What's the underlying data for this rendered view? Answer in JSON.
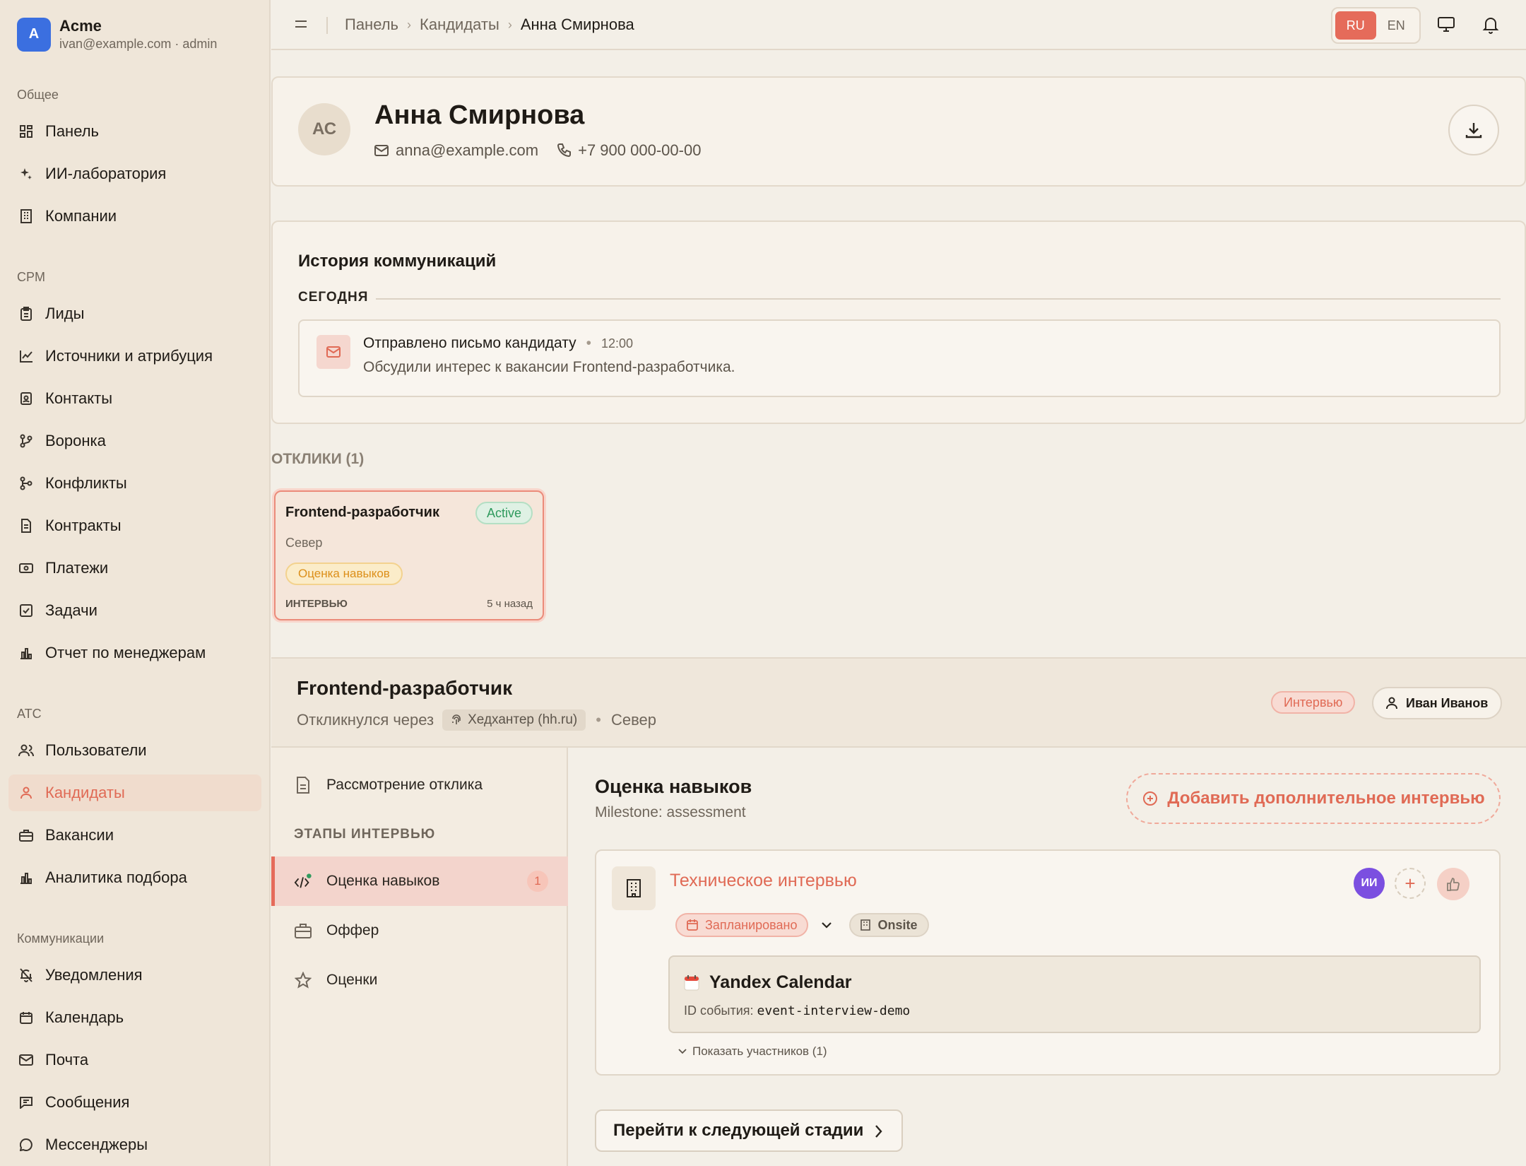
{
  "brand": {
    "initial": "A",
    "name": "Acme",
    "account": "ivan@example.com · admin"
  },
  "sidebar": {
    "sections": {
      "general": "Общее",
      "crm": "CPM",
      "ats": "ATC",
      "comms": "Коммуникации"
    },
    "items": [
      {
        "label": "Панель",
        "icon": "dashboard-icon"
      },
      {
        "label": "ИИ-лаборатория",
        "icon": "sparkles-icon"
      },
      {
        "label": "Компании",
        "icon": "building-icon"
      },
      {
        "label": "Лиды",
        "icon": "clipboard-icon"
      },
      {
        "label": "Источники и атрибуция",
        "icon": "chart-line-icon"
      },
      {
        "label": "Контакты",
        "icon": "contact-card-icon"
      },
      {
        "label": "Воронка",
        "icon": "funnel-icon"
      },
      {
        "label": "Конфликты",
        "icon": "git-branch-icon"
      },
      {
        "label": "Контракты",
        "icon": "document-icon"
      },
      {
        "label": "Платежи",
        "icon": "banknote-icon"
      },
      {
        "label": "Задачи",
        "icon": "checkbox-icon"
      },
      {
        "label": "Отчет по менеджерам",
        "icon": "bar-chart-icon"
      },
      {
        "label": "Пользователи",
        "icon": "users-icon"
      },
      {
        "label": "Кандидаты",
        "icon": "user-icon"
      },
      {
        "label": "Вакансии",
        "icon": "briefcase-icon"
      },
      {
        "label": "Аналитика подбора",
        "icon": "bar-chart-icon"
      },
      {
        "label": "Уведомления",
        "icon": "bell-off-icon"
      },
      {
        "label": "Календарь",
        "icon": "calendar-icon"
      },
      {
        "label": "Почта",
        "icon": "mail-icon"
      },
      {
        "label": "Сообщения",
        "icon": "message-square-icon"
      },
      {
        "label": "Мессенджеры",
        "icon": "message-circle-icon"
      }
    ],
    "active": "Кандидаты"
  },
  "topbar": {
    "breadcrumbs": [
      "Панель",
      "Кандидаты",
      "Анна Смирнова"
    ],
    "lang_on": "RU",
    "lang_off": "EN"
  },
  "candidate": {
    "initials": "АС",
    "name": "Анна Смирнова",
    "email": "anna@example.com",
    "phone": "+7 900 000-00-00"
  },
  "history": {
    "title": "История коммуникаций",
    "day": "СЕГОДНЯ",
    "event_title": "Отправлено письмо кандидату",
    "event_time": "12:00",
    "event_body": "Обсудили интерес к вакансии Frontend-разработчика."
  },
  "applications": {
    "label": "ОТКЛИКИ (1)",
    "card": {
      "title": "Frontend-разработчик",
      "status": "Active",
      "location": "Север",
      "stage_badge": "Оценка навыков",
      "stage": "ИНТЕРВЬЮ",
      "age": "5 ч назад"
    }
  },
  "vacancy": {
    "title": "Frontend-разработчик",
    "applied_via": "Откликнулся через",
    "source": "Хедхантер (hh.ru)",
    "location": "Север",
    "status_badge": "Интервью",
    "owner": "Иван Иванов"
  },
  "stages": {
    "review": "Рассмотрение отклика",
    "group": "ЭТАПЫ ИНТЕРВЬЮ",
    "items": [
      {
        "label": "Оценка навыков",
        "count": "1"
      },
      {
        "label": "Оффер"
      },
      {
        "label": "Оценки"
      }
    ]
  },
  "stage_detail": {
    "title": "Оценка навыков",
    "milestone": "Milestone: assessment",
    "add_button": "Добавить дополнительное интервью",
    "interview": {
      "title": "Техническое интервью",
      "status": "Запланировано",
      "format": "Onsite",
      "avatar": "ИИ",
      "calendar_name": "Yandex Calendar",
      "event_id_label": "ID события:",
      "event_id": "event-interview-demo",
      "participants": "Показать участников (1)"
    },
    "next_button": "Перейти к следующей стадии"
  },
  "colors": {
    "accent": "#e56b5a",
    "active_green": "#2f9a5d",
    "warning": "#dc8f1a",
    "brand_blue": "#3b6fe0",
    "avatar_purple": "#7b4fe0"
  }
}
